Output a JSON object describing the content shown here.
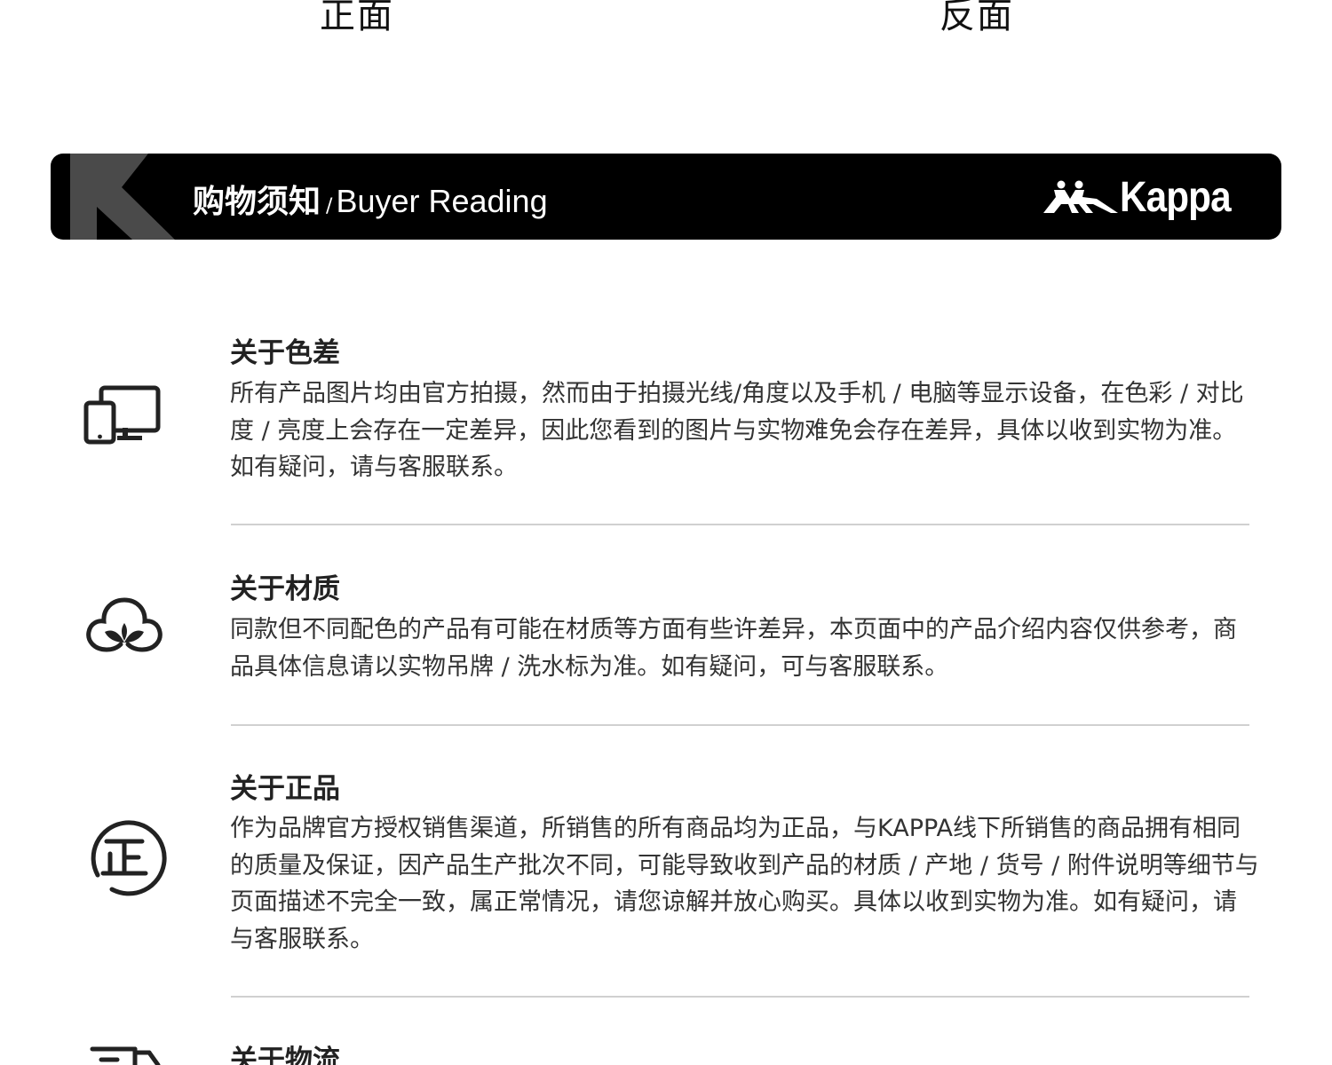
{
  "views": {
    "front": "正面",
    "back": "反面"
  },
  "banner": {
    "title_cn": "购物须知",
    "separator": "/",
    "title_en": "Buyer Reading",
    "brand": "Kappa"
  },
  "notices": [
    {
      "icon": "devices-icon",
      "title": "关于色差",
      "body": "所有产品图片均由官方拍摄，然而由于拍摄光线/角度以及手机 / 电脑等显示设备，在色彩 / 对比度 / 亮度上会存在一定差异，因此您看到的图片与实物难免会存在差异，具体以收到实物为准。如有疑问，请与客服联系。"
    },
    {
      "icon": "cotton-icon",
      "title": "关于材质",
      "body": "同款但不同配色的产品有可能在材质等方面有些许差异，本页面中的产品介绍内容仅供参考，商品具体信息请以实物吊牌 / 洗水标为准。如有疑问，可与客服联系。"
    },
    {
      "icon": "genuine-seal-icon",
      "title": "关于正品",
      "body": "作为品牌官方授权销售渠道，所销售的所有商品均为正品，与KAPPA线下所销售的商品拥有相同的质量及保证，因产品生产批次不同，可能导致收到产品的材质 / 产地 / 货号 /  附件说明等细节与页面描述不完全一致，属正常情况，请您谅解并放心购买。具体以收到实物为准。如有疑问，请与客服联系。"
    },
    {
      "icon": "delivery-truck-icon",
      "title": "关于物流",
      "body": ""
    }
  ]
}
